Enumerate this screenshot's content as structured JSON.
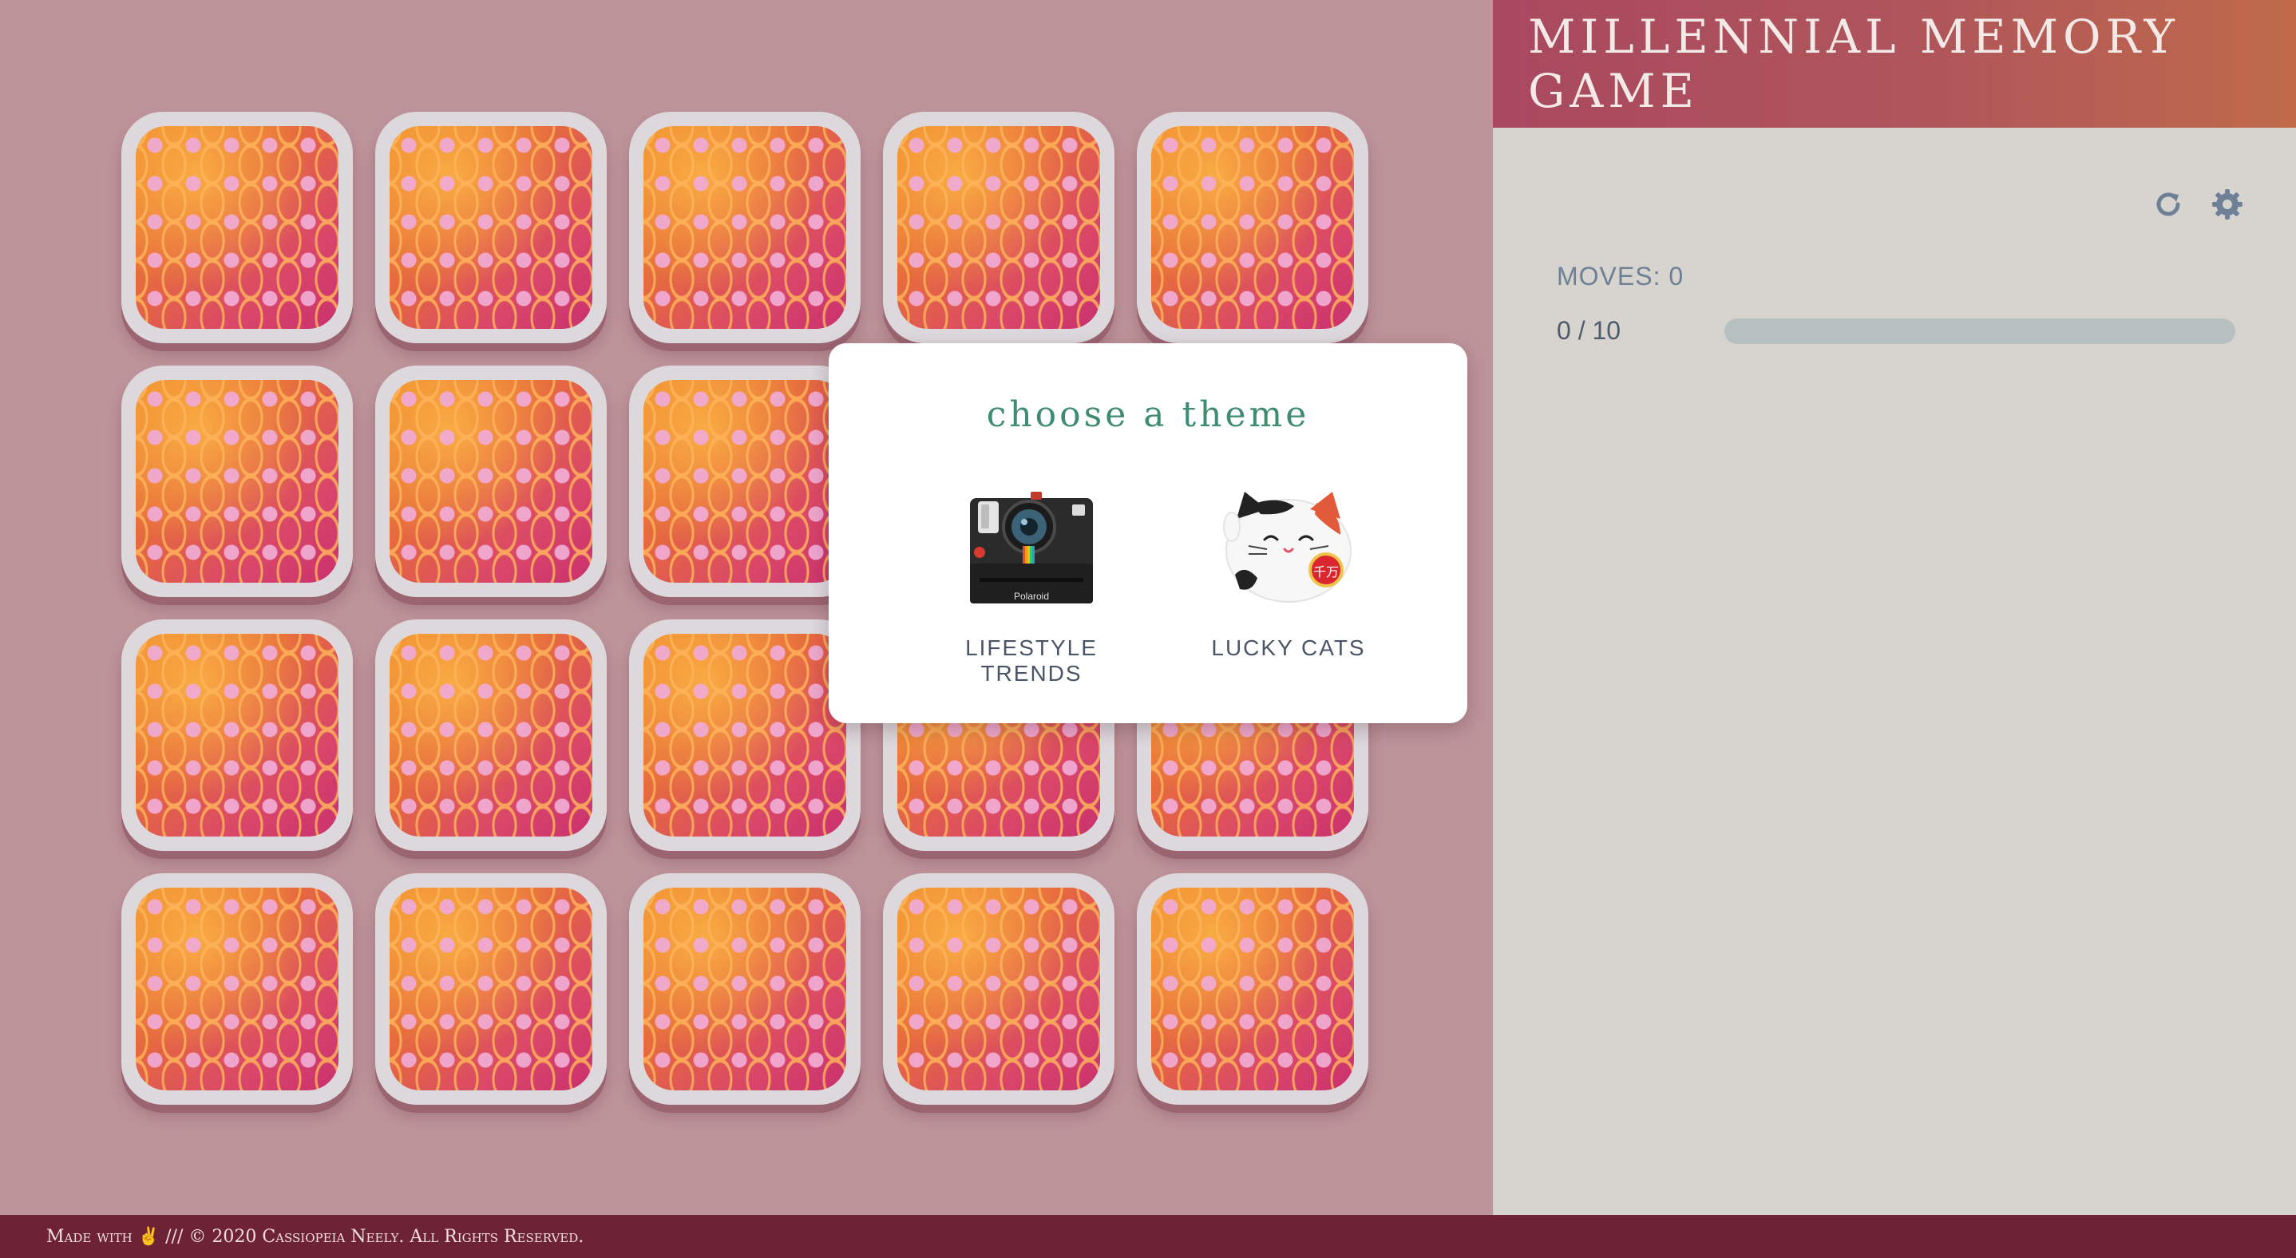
{
  "header": {
    "title": "MILLENNIAL MEMORY GAME"
  },
  "toolbar": {
    "restart_icon": "restart-icon",
    "settings_icon": "gear-icon"
  },
  "stats": {
    "moves": "MOVES: 0",
    "progress_text": "0 / 10",
    "progress_fraction": 0
  },
  "board": {
    "card_count": 20,
    "rows": 4,
    "columns": 5
  },
  "modal": {
    "title": "choose a theme",
    "themes": [
      {
        "label": "LIFESTYLE TRENDS",
        "icon": "polaroid-camera-icon",
        "brand_text": "Polaroid"
      },
      {
        "label": "LUCKY CATS",
        "icon": "lucky-cat-icon",
        "badge_text": "千万"
      }
    ]
  },
  "footer": {
    "text": "Made with ✌ /// © 2020 Cassiopeia Neely. All Rights Reserved."
  },
  "colors": {
    "board_bg": "#be949b",
    "sidebar_bg": "#d7d3ce",
    "header_gradient_start": "#a9485f",
    "header_gradient_end": "#c06a4a",
    "modal_title": "#3f8c6e",
    "footer_bg": "#6e2236",
    "progress_track": "#b6c0c1"
  }
}
